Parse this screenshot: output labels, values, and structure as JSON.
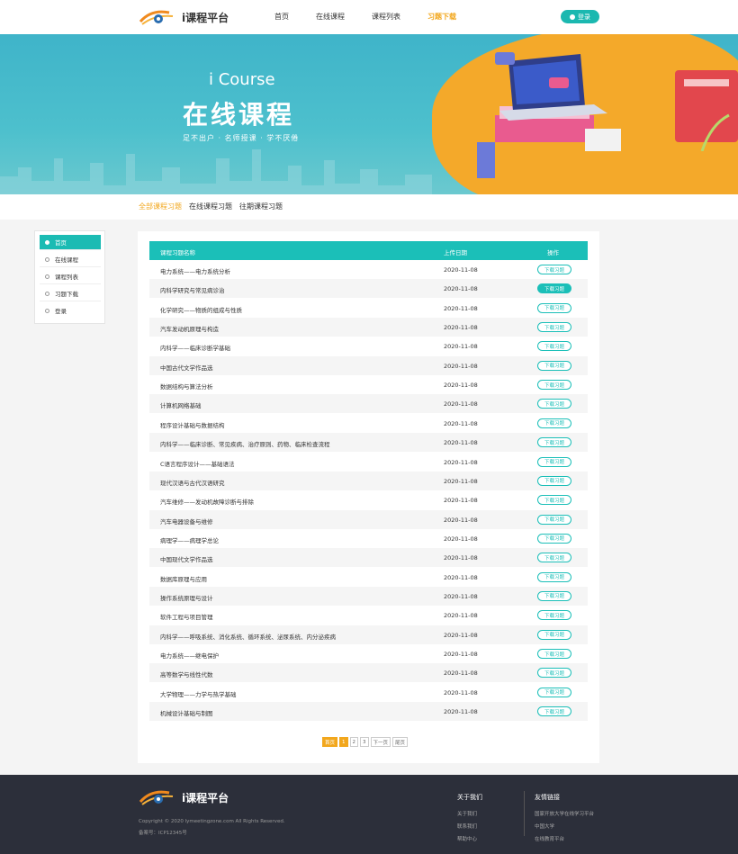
{
  "header": {
    "logo_text": "i课程平台",
    "nav": [
      "首页",
      "在线课程",
      "课程列表",
      "习题下载"
    ],
    "login_label": "登录"
  },
  "banner": {
    "subtitle": "i Course",
    "title": "在线课程",
    "slogan": "足不出户 · 名师授课 · 学不厌倦"
  },
  "subnav": [
    "全部课程习题",
    "在线课程习题",
    "往期课程习题"
  ],
  "sidebar": [
    "首页",
    "在线课程",
    "课程列表",
    "习题下载",
    "登录"
  ],
  "table": {
    "headers": [
      "课程习题名称",
      "上传日期",
      "操作"
    ],
    "download_label": "下载习题",
    "rows": [
      {
        "name": "电力系统——电力系统分析",
        "date": "2020-11-08",
        "filled": false
      },
      {
        "name": "内科学研究与常见病诊治",
        "date": "2020-11-08",
        "filled": true
      },
      {
        "name": "化学研究——物质的组成与性质",
        "date": "2020-11-08",
        "filled": false
      },
      {
        "name": "汽车发动机原理与构造",
        "date": "2020-11-08",
        "filled": false
      },
      {
        "name": "内科学——临床诊断学基础",
        "date": "2020-11-08",
        "filled": false
      },
      {
        "name": "中国古代文学作品选",
        "date": "2020-11-08",
        "filled": false
      },
      {
        "name": "数据结构与算法分析",
        "date": "2020-11-08",
        "filled": false
      },
      {
        "name": "计算机网络基础",
        "date": "2020-11-08",
        "filled": false
      },
      {
        "name": "程序设计基础与数据结构",
        "date": "2020-11-08",
        "filled": false
      },
      {
        "name": "内科学——临床诊断、常见疾病、治疗原则、药物、临床检查流程",
        "date": "2020-11-08",
        "filled": false
      },
      {
        "name": "C语言程序设计——基础语法",
        "date": "2020-11-08",
        "filled": false
      },
      {
        "name": "现代汉语与古代汉语研究",
        "date": "2020-11-08",
        "filled": false
      },
      {
        "name": "汽车维修——发动机故障诊断与排除",
        "date": "2020-11-08",
        "filled": false
      },
      {
        "name": "汽车电器设备与维修",
        "date": "2020-11-08",
        "filled": false
      },
      {
        "name": "病理学——病理学总论",
        "date": "2020-11-08",
        "filled": false
      },
      {
        "name": "中国现代文学作品选",
        "date": "2020-11-08",
        "filled": false
      },
      {
        "name": "数据库原理与应用",
        "date": "2020-11-08",
        "filled": false
      },
      {
        "name": "操作系统原理与设计",
        "date": "2020-11-08",
        "filled": false
      },
      {
        "name": "软件工程与项目管理",
        "date": "2020-11-08",
        "filled": false
      },
      {
        "name": "内科学——呼吸系统、消化系统、循环系统、泌尿系统、内分泌疾病",
        "date": "2020-11-08",
        "filled": false
      },
      {
        "name": "电力系统——继电保护",
        "date": "2020-11-08",
        "filled": false
      },
      {
        "name": "高等数学与线性代数",
        "date": "2020-11-08",
        "filled": false
      },
      {
        "name": "大学物理——力学与热学基础",
        "date": "2020-11-08",
        "filled": false
      },
      {
        "name": "机械设计基础与制图",
        "date": "2020-11-08",
        "filled": false
      }
    ]
  },
  "pager": [
    "首页",
    "1",
    "2",
    "3",
    "下一页",
    "尾页"
  ],
  "footer": {
    "logo_text": "i课程平台",
    "copyright": "Copyright © 2020 lymeetingzone.com All Rights Reserved.",
    "icp": "备案号：ICP12345号",
    "col1_head": "关于我们",
    "col1_links": [
      "关于我们",
      "联系我们",
      "帮助中心"
    ],
    "col2_head": "友情链接",
    "col2_links": [
      "国家开放大学在线学习平台",
      "中国大学",
      "在线教育平台"
    ]
  }
}
